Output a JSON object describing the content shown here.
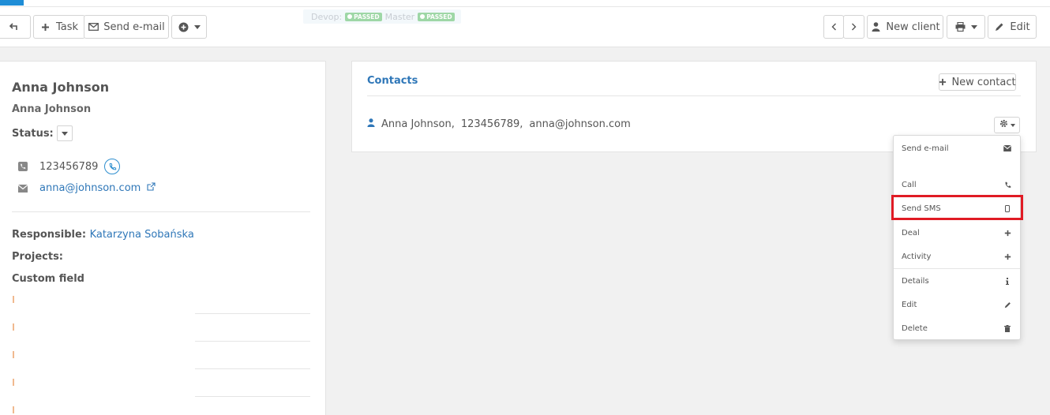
{
  "toolbar": {
    "back_label": "",
    "task_label": "Task",
    "send_email_label": "Send e-mail",
    "new_client_label": "New client",
    "edit_label": "Edit"
  },
  "ci": {
    "devop_label": "Devop:",
    "devop_status": "PASSED",
    "master_label": "Master",
    "master_status": "PASSED"
  },
  "client": {
    "name": "Anna Johnson",
    "subname": "Anna Johnson",
    "status_label": "Status:",
    "phone": "123456789",
    "email": "anna@johnson.com",
    "responsible_label": "Responsible:",
    "responsible_value": "Katarzyna Sobańska",
    "projects_label": "Projects:",
    "custom_field_label": "Custom field"
  },
  "contacts": {
    "title": "Contacts",
    "new_contact_label": "New contact",
    "row": {
      "name": "Anna Johnson,",
      "phone": "123456789,",
      "email": "anna@johnson.com"
    }
  },
  "menu": {
    "items": [
      {
        "label": "Send e-mail",
        "icon": "envelope-icon"
      },
      {
        "label": "Call",
        "icon": "phone-icon"
      },
      {
        "label": "Send SMS",
        "icon": "mobile-icon"
      },
      {
        "label": "Deal",
        "icon": "plus-icon"
      },
      {
        "label": "Activity",
        "icon": "plus-icon"
      },
      {
        "label": "Details",
        "icon": "info-icon"
      },
      {
        "label": "Edit",
        "icon": "pencil-icon"
      },
      {
        "label": "Delete",
        "icon": "trash-icon"
      }
    ]
  },
  "colors": {
    "accent": "#1f8dd6",
    "link": "#2f77b8",
    "passed_badge": "#9ed7a6",
    "highlight": "#e01b24"
  }
}
